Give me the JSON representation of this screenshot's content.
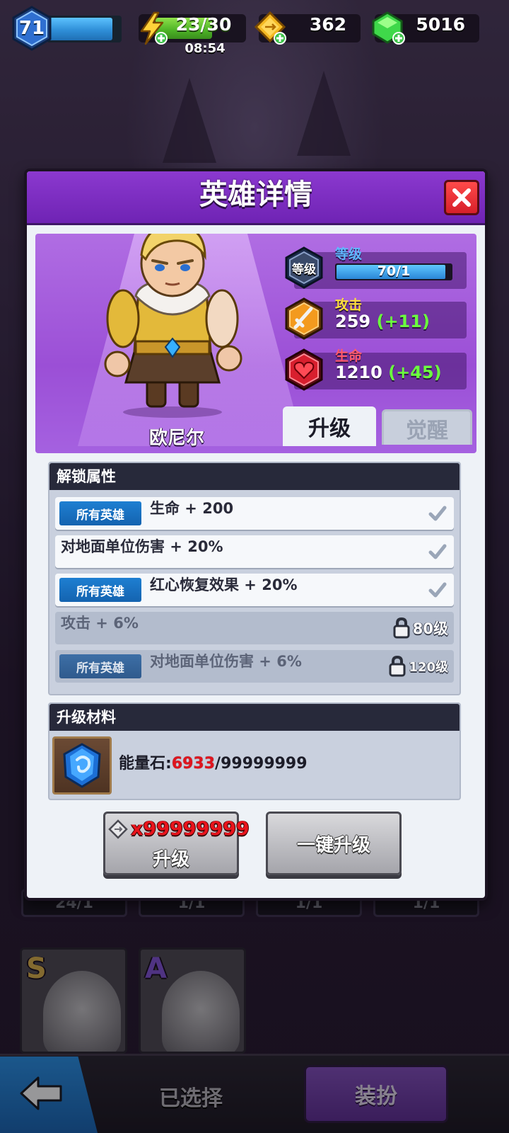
{
  "hud": {
    "player_level": "71",
    "player_xp_progress": 0.9,
    "energy": "23/30",
    "energy_progress": 0.77,
    "energy_timer": "08:54",
    "tickets": "362",
    "gems": "5016",
    "icons": [
      "level-hexagon-icon",
      "lightning-icon",
      "ticket-icon",
      "gem-icon",
      "plus-icon"
    ]
  },
  "modal": {
    "title": "英雄详情",
    "close_icon": "close-icon",
    "hero": {
      "name": "欧尼尔",
      "level_label": "等级",
      "level_badge": "等级",
      "level_value": "70/1",
      "level_progress": 0.95,
      "attack_label": "攻击",
      "attack_value": "259",
      "attack_bonus": "(+11)",
      "hp_label": "生命",
      "hp_value": "1210",
      "hp_bonus": "(+45)"
    },
    "tabs": {
      "upgrade": "升级",
      "awaken": "觉醒"
    },
    "unlock": {
      "title": "解锁属性",
      "items": [
        {
          "chip": "所有英雄",
          "text": "生命 + 200",
          "state": "unlocked"
        },
        {
          "chip": "",
          "text": "对地面单位伤害 + 20%",
          "state": "unlocked"
        },
        {
          "chip": "所有英雄",
          "text": "红心恢复效果 + 20%",
          "state": "unlocked"
        },
        {
          "chip": "",
          "text": "攻击 + 6%",
          "state": "locked",
          "lock_level": "80级"
        },
        {
          "chip": "所有英雄",
          "text": "对地面单位伤害 + 6%",
          "state": "locked",
          "lock_level": "120级"
        }
      ]
    },
    "materials": {
      "title": "升级材料",
      "item_icon": "energy-stone-icon",
      "label": "能量石:",
      "have": "6933",
      "need": "/99999999"
    },
    "buttons": {
      "upgrade_cost": "x99999999",
      "upgrade_label": "升级",
      "one_click": "一键升级"
    }
  },
  "background": {
    "slot_labels": [
      "24/1",
      "1/1",
      "1/1",
      "1/1"
    ],
    "cards": [
      {
        "rank": "S",
        "rank_color": "#c9a44a"
      },
      {
        "rank": "A",
        "rank_color": "#7a4fc8"
      }
    ],
    "selected_label": "已选择",
    "dress_label": "装扮"
  },
  "colors": {
    "header_purple": "#7a2cc2",
    "bonus_green": "#6bff3e",
    "cost_red": "#e8141c",
    "chip_blue": "#1a73c8"
  }
}
